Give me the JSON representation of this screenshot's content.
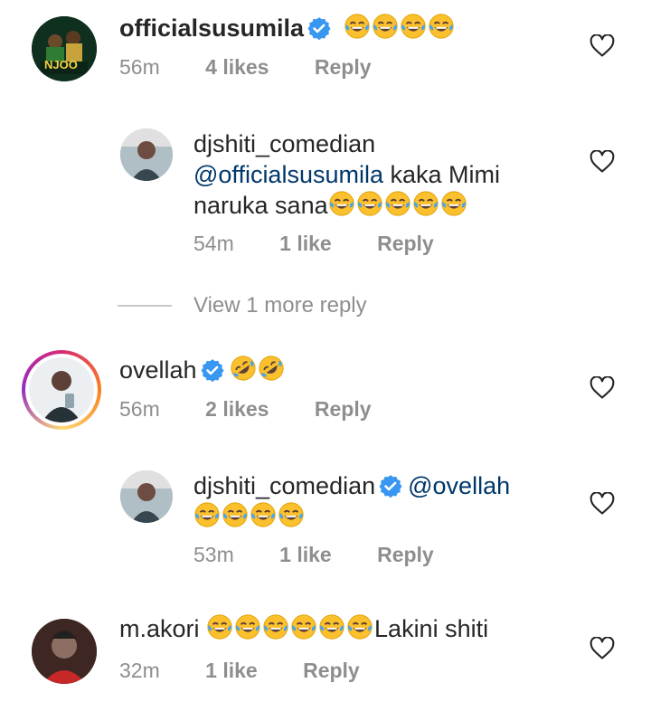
{
  "comments": [
    {
      "username": "officialsusumila",
      "verified": true,
      "text_emoji_count": 4,
      "emoji": "joy",
      "time": "56m",
      "likes": "4 likes",
      "reply": "Reply",
      "avatar_text": "NJOO",
      "replies": [
        {
          "username": "djshiti_comedian",
          "verified": false,
          "mention": "@officialsusumila",
          "text_line1": " kaka Mimi",
          "text_line2": "naruka sana",
          "emoji_count": 5,
          "time": "54m",
          "likes": "1 like",
          "reply": "Reply"
        }
      ],
      "view_more": "View 1 more reply"
    },
    {
      "username": "ovellah",
      "verified": true,
      "emoji": "rofl",
      "emoji_count": 2,
      "time": "56m",
      "likes": "2 likes",
      "reply": "Reply",
      "replies": [
        {
          "username": "djshiti_comedian",
          "verified": true,
          "mention": "@ovellah",
          "emoji_count": 4,
          "time": "53m",
          "likes": "1 like",
          "reply": "Reply"
        }
      ]
    },
    {
      "username": "m.akori",
      "verified": false,
      "emoji_count": 6,
      "text_after": "Lakini shiti",
      "time": "32m",
      "likes": "1 like",
      "reply": "Reply"
    }
  ],
  "colors": {
    "text": "#262626",
    "meta": "#8e8e8e",
    "mention": "#00376b",
    "verified": "#3897f0",
    "emoji_face": "#fbc02d",
    "tears": "#42a5f5"
  }
}
